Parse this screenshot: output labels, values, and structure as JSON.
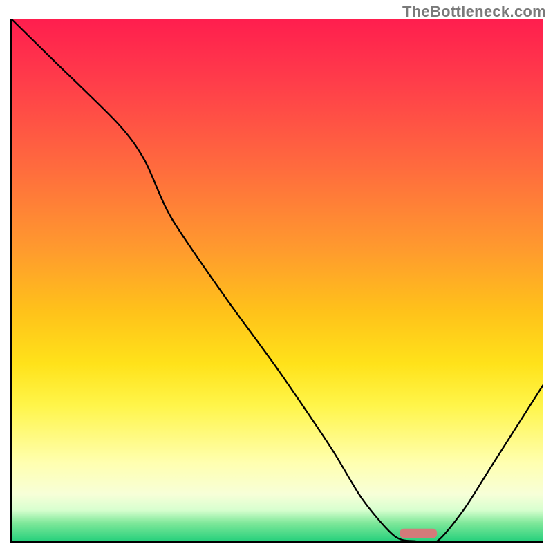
{
  "watermark": "TheBottleneck.com",
  "chart_data": {
    "type": "line",
    "title": "",
    "xlabel": "",
    "ylabel": "",
    "xlim": [
      0,
      100
    ],
    "ylim": [
      0,
      100
    ],
    "x": [
      0,
      8,
      20,
      25,
      30,
      40,
      50,
      60,
      66,
      72,
      76,
      80,
      85,
      90,
      95,
      100
    ],
    "y": [
      100,
      92,
      80,
      73,
      62,
      47,
      33,
      18,
      8,
      1,
      0,
      0,
      6,
      14,
      22,
      30
    ],
    "marker": {
      "x_range": [
        73,
        80
      ],
      "y": 1.5,
      "color": "#d47a7a"
    },
    "background": "rainbow-gradient-red-to-green-vertical"
  }
}
